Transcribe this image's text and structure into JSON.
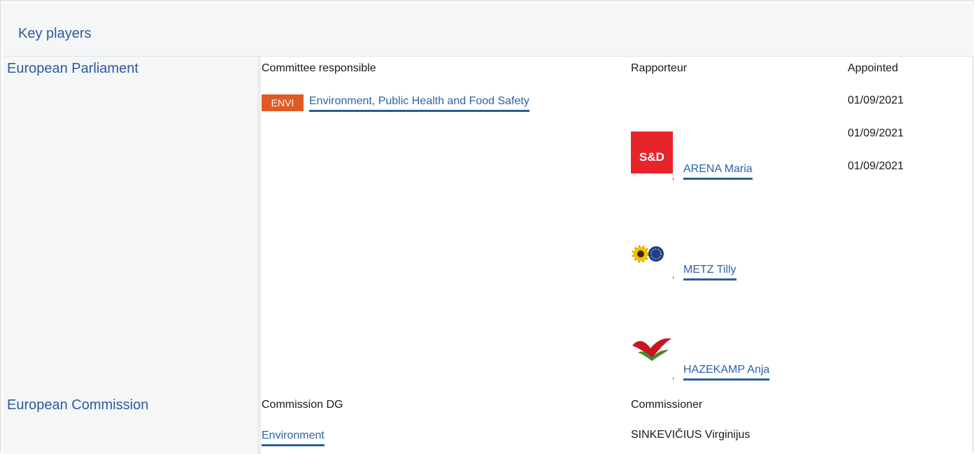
{
  "section": {
    "title": "Key players"
  },
  "parliament": {
    "label": "European Parliament",
    "committee_header": "Committee responsible",
    "rapporteur_header": "Rapporteur",
    "appointed_header": "Appointed",
    "committee_code": "ENVI",
    "committee_name": "Environment, Public Health and Food Safety",
    "rapporteurs": [
      {
        "name": "ARENA Maria",
        "group_logo": "sd-logo",
        "appointed": "01/09/2021"
      },
      {
        "name": "METZ Tilly",
        "group_logo": "greens-efa-logo",
        "appointed": "01/09/2021"
      },
      {
        "name": "HAZEKAMP Anja",
        "group_logo": "gue-ngl-logo",
        "appointed": "01/09/2021"
      }
    ],
    "dates": [
      "01/09/2021",
      "01/09/2021",
      "01/09/2021"
    ]
  },
  "commission": {
    "label": "European Commission",
    "dg_header": "Commission DG",
    "commissioner_header": "Commissioner",
    "dg_name": "Environment",
    "commissioner_name": "SINKEVIČIUS Virginijus"
  },
  "colors": {
    "link": "#2f63a8",
    "badge": "#e05a24",
    "header_bg": "#f5f6f8"
  }
}
